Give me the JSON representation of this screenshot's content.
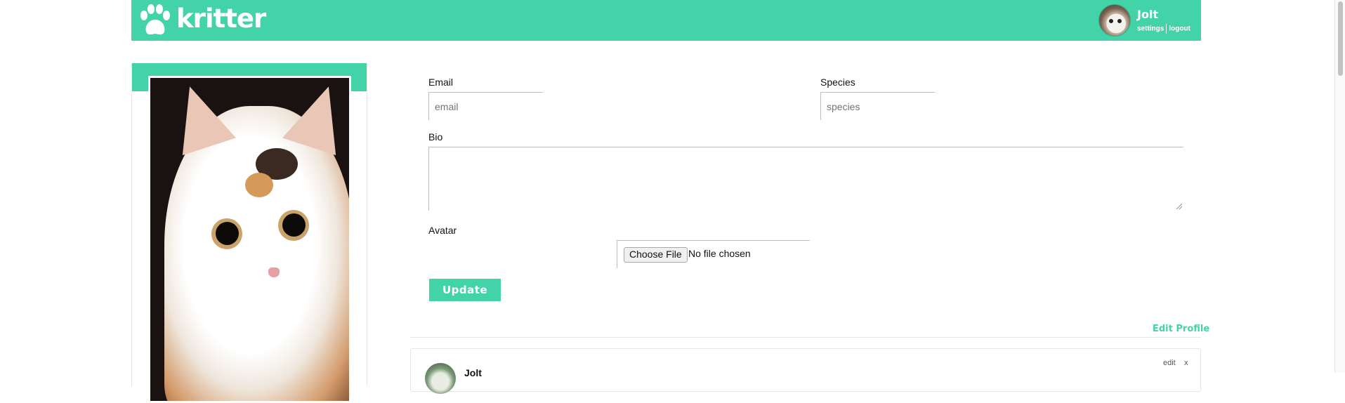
{
  "header": {
    "brand": "kritter",
    "user": {
      "name": "Jolt",
      "settings_label": "settings",
      "logout_label": "logout"
    }
  },
  "form": {
    "email": {
      "label": "Email",
      "placeholder": "email"
    },
    "species": {
      "label": "Species",
      "placeholder": "species"
    },
    "bio": {
      "label": "Bio"
    },
    "avatar": {
      "label": "Avatar",
      "button_label": "Choose File",
      "status": "No file chosen"
    },
    "update_label": "Update"
  },
  "edit_profile_label": "Edit Profile",
  "post": {
    "author": "Jolt",
    "edit_label": "edit",
    "delete_label": "x"
  },
  "colors": {
    "accent": "#43d3a8"
  }
}
